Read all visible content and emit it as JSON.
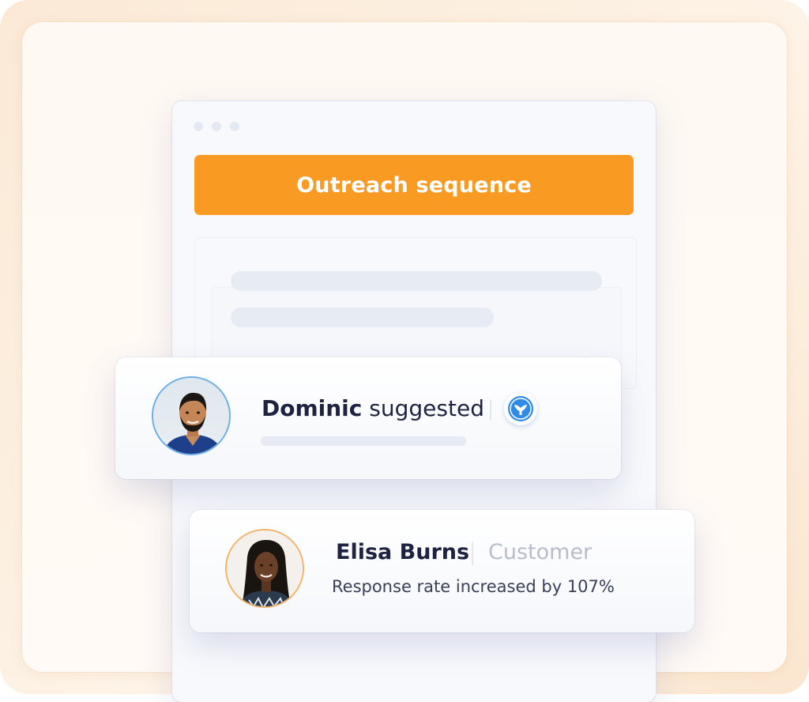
{
  "header": {
    "title": "Outreach sequence"
  },
  "suggestion": {
    "name": "Dominic",
    "action": " suggested",
    "avatar_icon": "person-avatar-icon",
    "logo_icon": "whale-tail-logo-icon"
  },
  "testimonial": {
    "name": "Elisa Burns",
    "role": "Customer",
    "stat": "Response rate increased by 107%",
    "avatar_icon": "person-avatar-icon"
  },
  "colors": {
    "accent_orange": "#f99a22",
    "logo_blue": "#2f8ae8",
    "text_dark": "#1d2340",
    "text_muted": "#b7bdcc"
  }
}
